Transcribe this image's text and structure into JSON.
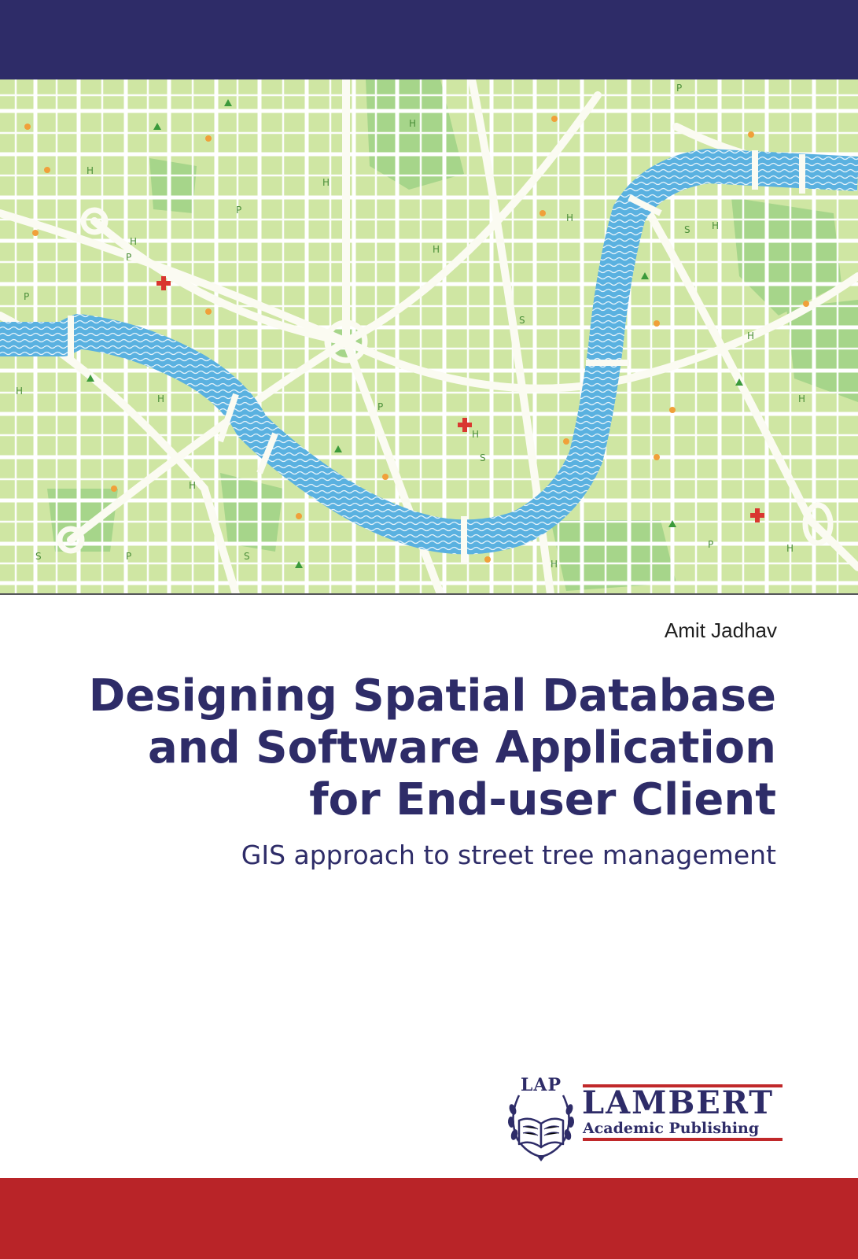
{
  "cover": {
    "author": "Amit Jadhav",
    "title_lines": [
      "Designing Spatial Database",
      "and Software Application",
      "for End-user Client"
    ],
    "subtitle": "GIS approach to street tree management"
  },
  "publisher": {
    "emblem_text": "LAP",
    "name": "LAMBERT",
    "subname": "Academic Publishing"
  },
  "colors": {
    "navy": "#2e2c68",
    "red": "#b92428",
    "map_green": "#cfe6a3",
    "park_green": "#a6d58a",
    "river_blue": "#5ab1e0",
    "road": "#ffffff"
  },
  "map_symbols": {
    "hospital": "red cross",
    "poi": "orange star",
    "park": "green triangle",
    "labels": [
      "H",
      "P",
      "S"
    ]
  }
}
